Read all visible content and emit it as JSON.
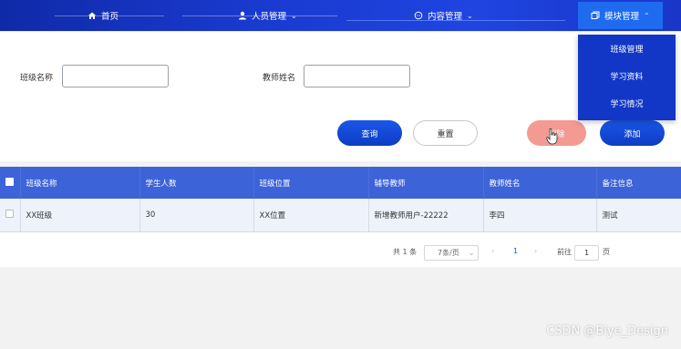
{
  "nav": {
    "items": [
      {
        "label": "首页",
        "icon": "home-icon"
      },
      {
        "label": "人员管理",
        "icon": "user-icon"
      },
      {
        "label": "内容管理",
        "icon": "chat-icon"
      },
      {
        "label": "模块管理",
        "icon": "module-icon",
        "active": true
      }
    ],
    "dropdown": [
      "班级管理",
      "学习资料",
      "学习情况"
    ]
  },
  "search": {
    "class_name_label": "班级名称",
    "teacher_name_label": "教师姓名",
    "class_name_value": "",
    "teacher_name_value": ""
  },
  "buttons": {
    "query": "查询",
    "reset": "重置",
    "delete": "删除",
    "add": "添加"
  },
  "table": {
    "headers": [
      "班级名称",
      "学生人数",
      "班级位置",
      "辅导教师",
      "教师姓名",
      "备注信息"
    ],
    "rows": [
      [
        "XX班级",
        "30",
        "XX位置",
        "新增教师用户-22222",
        "李四",
        "测试"
      ]
    ]
  },
  "pagination": {
    "total": "共 1 条",
    "page_size": "7条/页",
    "current_page": "1",
    "prev": "‹",
    "next": "›",
    "goto_label": "前往",
    "goto_value": "1",
    "page_suffix": "页"
  },
  "watermark": "CSDN @Biye_Design",
  "colors": {
    "nav_bg": "#1a3bd1",
    "primary": "#1a57e8",
    "danger": "#f39a93",
    "table_header": "#3d63d8"
  }
}
